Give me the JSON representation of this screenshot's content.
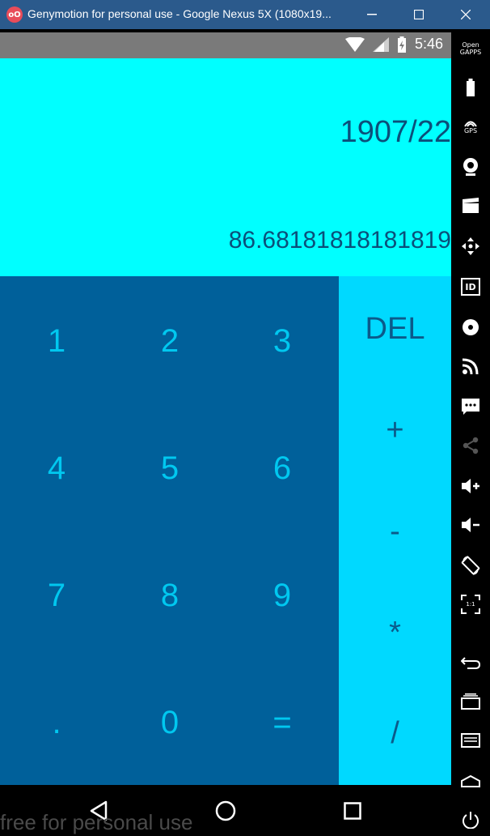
{
  "window": {
    "title": "Genymotion for personal use - Google Nexus 5X (1080x19...",
    "logo_text": "oO"
  },
  "status": {
    "time": "5:46"
  },
  "display": {
    "expression": "1907/22",
    "result": "86.68181818181819"
  },
  "keys": [
    "1",
    "2",
    "3",
    "4",
    "5",
    "6",
    "7",
    "8",
    "9",
    ".",
    "0",
    "="
  ],
  "operators": [
    "DEL",
    "+",
    "-",
    "*",
    "/"
  ],
  "watermark": "free for personal use",
  "toolbar": {
    "open_gapps": "Open\nGAPPS",
    "gps": "GPS",
    "id": "ID",
    "ratio": "1:1"
  }
}
